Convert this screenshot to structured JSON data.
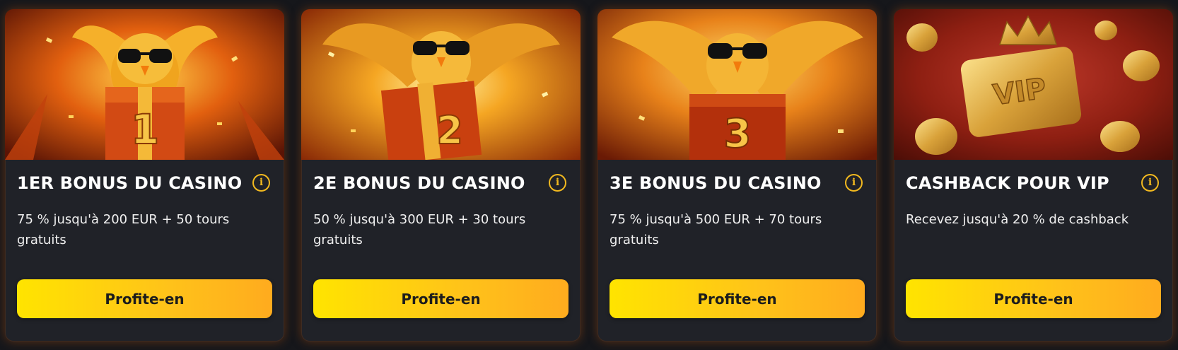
{
  "cards": [
    {
      "title": "1ER BONUS DU CASINO",
      "description": "75 % jusqu'à 200 EUR + 50 tours gratuits",
      "button": "Profite-en",
      "badge_number": "1",
      "icon": "info-icon",
      "art": "owl-with-sunglasses-holding-gift-box-1"
    },
    {
      "title": "2E BONUS DU CASINO",
      "description": "50 % jusqu'à 300 EUR + 30 tours gratuits",
      "button": "Profite-en",
      "badge_number": "2",
      "icon": "info-icon",
      "art": "owl-with-sunglasses-holding-gift-box-2"
    },
    {
      "title": "3E BONUS DU CASINO",
      "description": "75 % jusqu'à 500 EUR + 70 tours gratuits",
      "button": "Profite-en",
      "badge_number": "3",
      "icon": "info-icon",
      "art": "owl-with-sunglasses-holding-gift-box-3"
    },
    {
      "title": "CASHBACK POUR VIP",
      "description": "Recevez jusqu'à 20 % de cashback",
      "button": "Profite-en",
      "badge_text": "VIP",
      "icon": "info-icon",
      "art": "golden-vip-card-with-crown-and-coins"
    }
  ],
  "colors": {
    "page_background": "#16171b",
    "card_background": "#202228",
    "accent_yellow": "#ffe400",
    "accent_orange": "#ffab1e",
    "info_icon": "#f2b91f"
  }
}
